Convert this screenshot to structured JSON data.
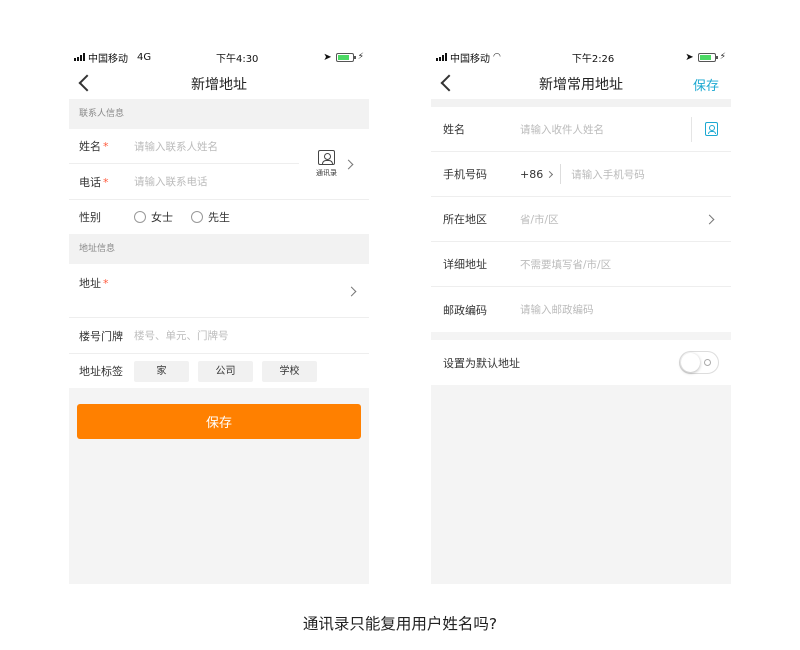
{
  "left": {
    "status": {
      "carrier": "中国移动",
      "network": "4G",
      "time": "下午4:30",
      "battery_level": 0.8
    },
    "nav": {
      "title": "新增地址"
    },
    "sections": {
      "contact_header": "联系人信息",
      "address_header": "地址信息"
    },
    "name": {
      "label": "姓名",
      "required": "*",
      "placeholder": "请输入联系人姓名"
    },
    "phone": {
      "label": "电话",
      "required": "*",
      "placeholder": "请输入联系电话"
    },
    "contacts_button": {
      "label": "通讯录"
    },
    "gender": {
      "label": "性别",
      "options": [
        "女士",
        "先生"
      ]
    },
    "address": {
      "label": "地址",
      "required": "*"
    },
    "house_number": {
      "label": "楼号门牌",
      "placeholder": "楼号、单元、门牌号"
    },
    "tags": {
      "label": "地址标签",
      "options": [
        "家",
        "公司",
        "学校"
      ]
    },
    "save_button": "保存",
    "accent": "#ff8000"
  },
  "right": {
    "status": {
      "carrier": "中国移动",
      "time": "下午2:26",
      "battery_level": 0.8
    },
    "nav": {
      "title": "新增常用地址",
      "action": "保存"
    },
    "name": {
      "label": "姓名",
      "placeholder": "请输入收件人姓名"
    },
    "phone": {
      "label": "手机号码",
      "country_code": "+86",
      "placeholder": "请输入手机号码"
    },
    "region": {
      "label": "所在地区",
      "placeholder": "省/市/区"
    },
    "detail": {
      "label": "详细地址",
      "placeholder": "不需要填写省/市/区"
    },
    "postcode": {
      "label": "邮政编码",
      "placeholder": "请输入邮政编码"
    },
    "default_toggle": {
      "label": "设置为默认地址",
      "on": false
    },
    "accent": "#1ba8d1"
  },
  "caption": "通讯录只能复用用户姓名吗?"
}
